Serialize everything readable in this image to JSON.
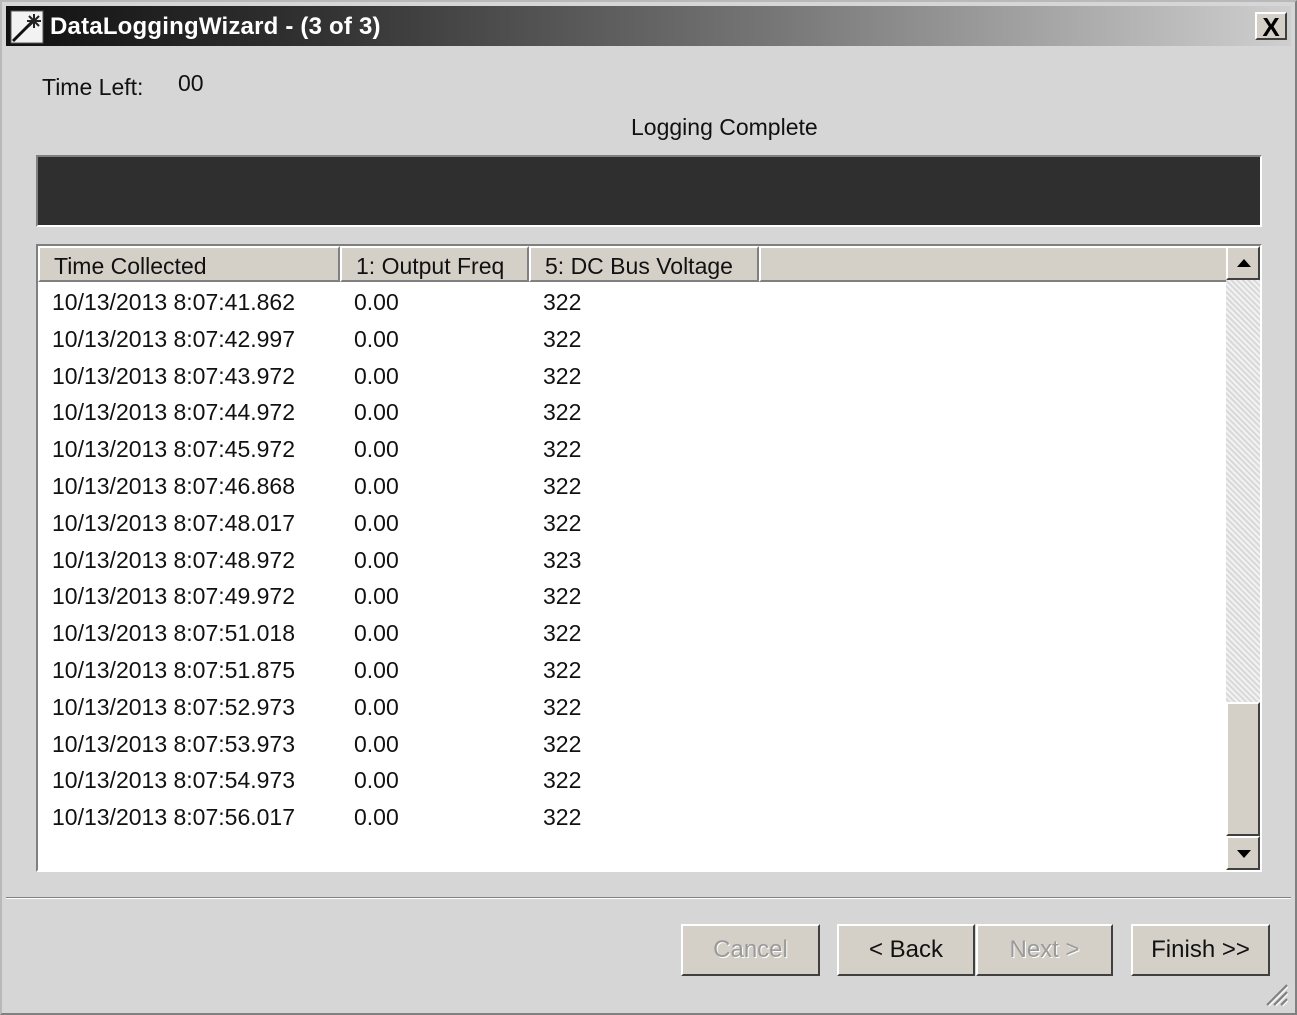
{
  "window": {
    "title": "DataLoggingWizard - (3 of 3)",
    "close_glyph": "X"
  },
  "status": {
    "time_left_label": "Time Left:",
    "time_left_value": "00",
    "message": "Logging Complete",
    "progress_percent": 100
  },
  "table": {
    "columns": [
      "Time Collected",
      "1: Output Freq",
      "5: DC Bus Voltage"
    ],
    "rows": [
      [
        "10/13/2013 8:07:41.862",
        "0.00",
        "322"
      ],
      [
        "10/13/2013 8:07:42.997",
        "0.00",
        "322"
      ],
      [
        "10/13/2013 8:07:43.972",
        "0.00",
        "322"
      ],
      [
        "10/13/2013 8:07:44.972",
        "0.00",
        "322"
      ],
      [
        "10/13/2013 8:07:45.972",
        "0.00",
        "322"
      ],
      [
        "10/13/2013 8:07:46.868",
        "0.00",
        "322"
      ],
      [
        "10/13/2013 8:07:48.017",
        "0.00",
        "322"
      ],
      [
        "10/13/2013 8:07:48.972",
        "0.00",
        "323"
      ],
      [
        "10/13/2013 8:07:49.972",
        "0.00",
        "322"
      ],
      [
        "10/13/2013 8:07:51.018",
        "0.00",
        "322"
      ],
      [
        "10/13/2013 8:07:51.875",
        "0.00",
        "322"
      ],
      [
        "10/13/2013 8:07:52.973",
        "0.00",
        "322"
      ],
      [
        "10/13/2013 8:07:53.973",
        "0.00",
        "322"
      ],
      [
        "10/13/2013 8:07:54.973",
        "0.00",
        "322"
      ],
      [
        "10/13/2013 8:07:56.017",
        "0.00",
        "322"
      ]
    ]
  },
  "buttons": {
    "cancel": "Cancel",
    "back": "< Back",
    "next": "Next >",
    "finish": "Finish >>"
  },
  "colors": {
    "progress_fill": "#2f2f2f",
    "disabled_text": "#9a9a9a"
  },
  "icons": {
    "app": "wizard-icon",
    "scroll_up": "arrow-up-icon",
    "scroll_down": "arrow-down-icon",
    "grip": "resize-grip-icon"
  }
}
